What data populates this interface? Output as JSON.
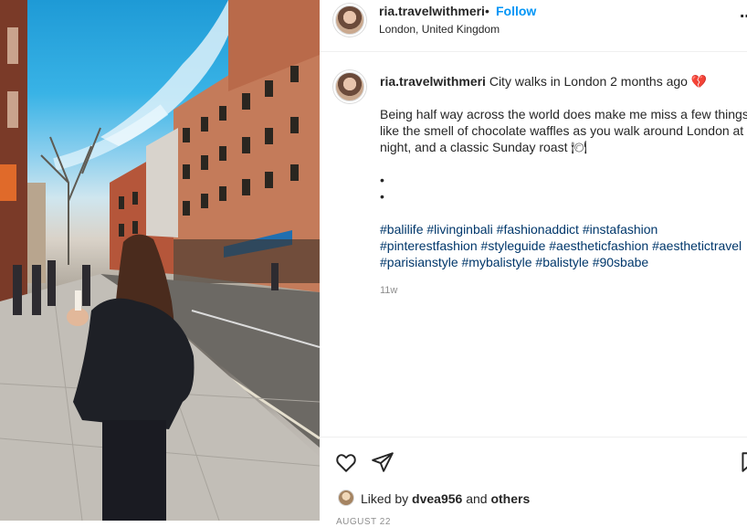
{
  "post": {
    "image_alt": "Woman in denim jacket standing on a London street with brick buildings and blue sky",
    "username": "ria.travelwithmeri",
    "separator": "•",
    "follow_label": "Follow",
    "location": "London, United Kingdom",
    "more_icon": "more-options-icon"
  },
  "caption": {
    "username": "ria.travelwithmeri",
    "title": "City walks in London 2 months ago",
    "title_emoji": "💔",
    "body_lines": [
      "Being half way across the world does make me miss a few things,",
      "like the smell of chocolate waffles as you walk around London at",
      "night, and a classic Sunday roast 🍽"
    ],
    "bullets": [
      "•",
      "•"
    ],
    "hashtag_lines": [
      [
        "#balilife",
        "#livinginbali",
        "#fashionaddict",
        "#instafashion"
      ],
      [
        "#pinterestfashion",
        "#styleguide",
        "#aestheticfashion",
        "#aesthetictravel"
      ],
      [
        "#parisianstyle",
        "#mybalistyle",
        "#balistyle",
        "#90sbabe"
      ]
    ],
    "age": "11w"
  },
  "actions": {
    "like_icon": "heart-icon",
    "share_icon": "share-icon",
    "save_icon": "bookmark-icon",
    "liked_prefix": "Liked by",
    "liked_user": "dvea956",
    "liked_conj": "and",
    "liked_others": "others",
    "date": "AUGUST 22"
  },
  "colors": {
    "link": "#0095f6",
    "hashtag": "#00376b",
    "muted": "#8e8e8e",
    "text": "#262626"
  }
}
